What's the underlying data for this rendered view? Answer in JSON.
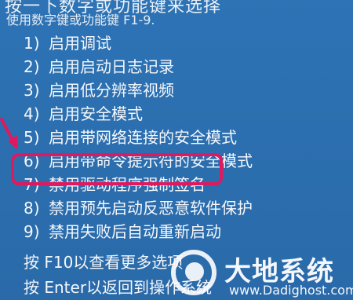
{
  "top_cut_text": "按一下数字或功能键来选择",
  "hint": "使用数字键或功能键 F1-9.",
  "options": [
    {
      "num": "1)",
      "label": "启用调试"
    },
    {
      "num": "2)",
      "label": "启用启动日志记录"
    },
    {
      "num": "3)",
      "label": "启用低分辨率视频"
    },
    {
      "num": "4)",
      "label": "启用安全模式"
    },
    {
      "num": "5)",
      "label": "启用带网络连接的安全模式"
    },
    {
      "num": "6)",
      "label": "启用带命令提示符的安全模式"
    },
    {
      "num": "7)",
      "label": "禁用驱动程序强制签名"
    },
    {
      "num": "8)",
      "label": "禁用预先启动反恶意软件保护"
    },
    {
      "num": "9)",
      "label": "禁用失败后自动重新启动"
    }
  ],
  "footer": {
    "line1": "按 F10以查看更多选项",
    "line2": "按 Enter以返回到操作系统"
  },
  "watermark": {
    "title": "大地系统",
    "url": "www.Dadighost.com"
  },
  "colors": {
    "background": "#2d73b5",
    "highlight": "#e0195e",
    "text": "#f5f7fb"
  },
  "selected_option_index": 6
}
